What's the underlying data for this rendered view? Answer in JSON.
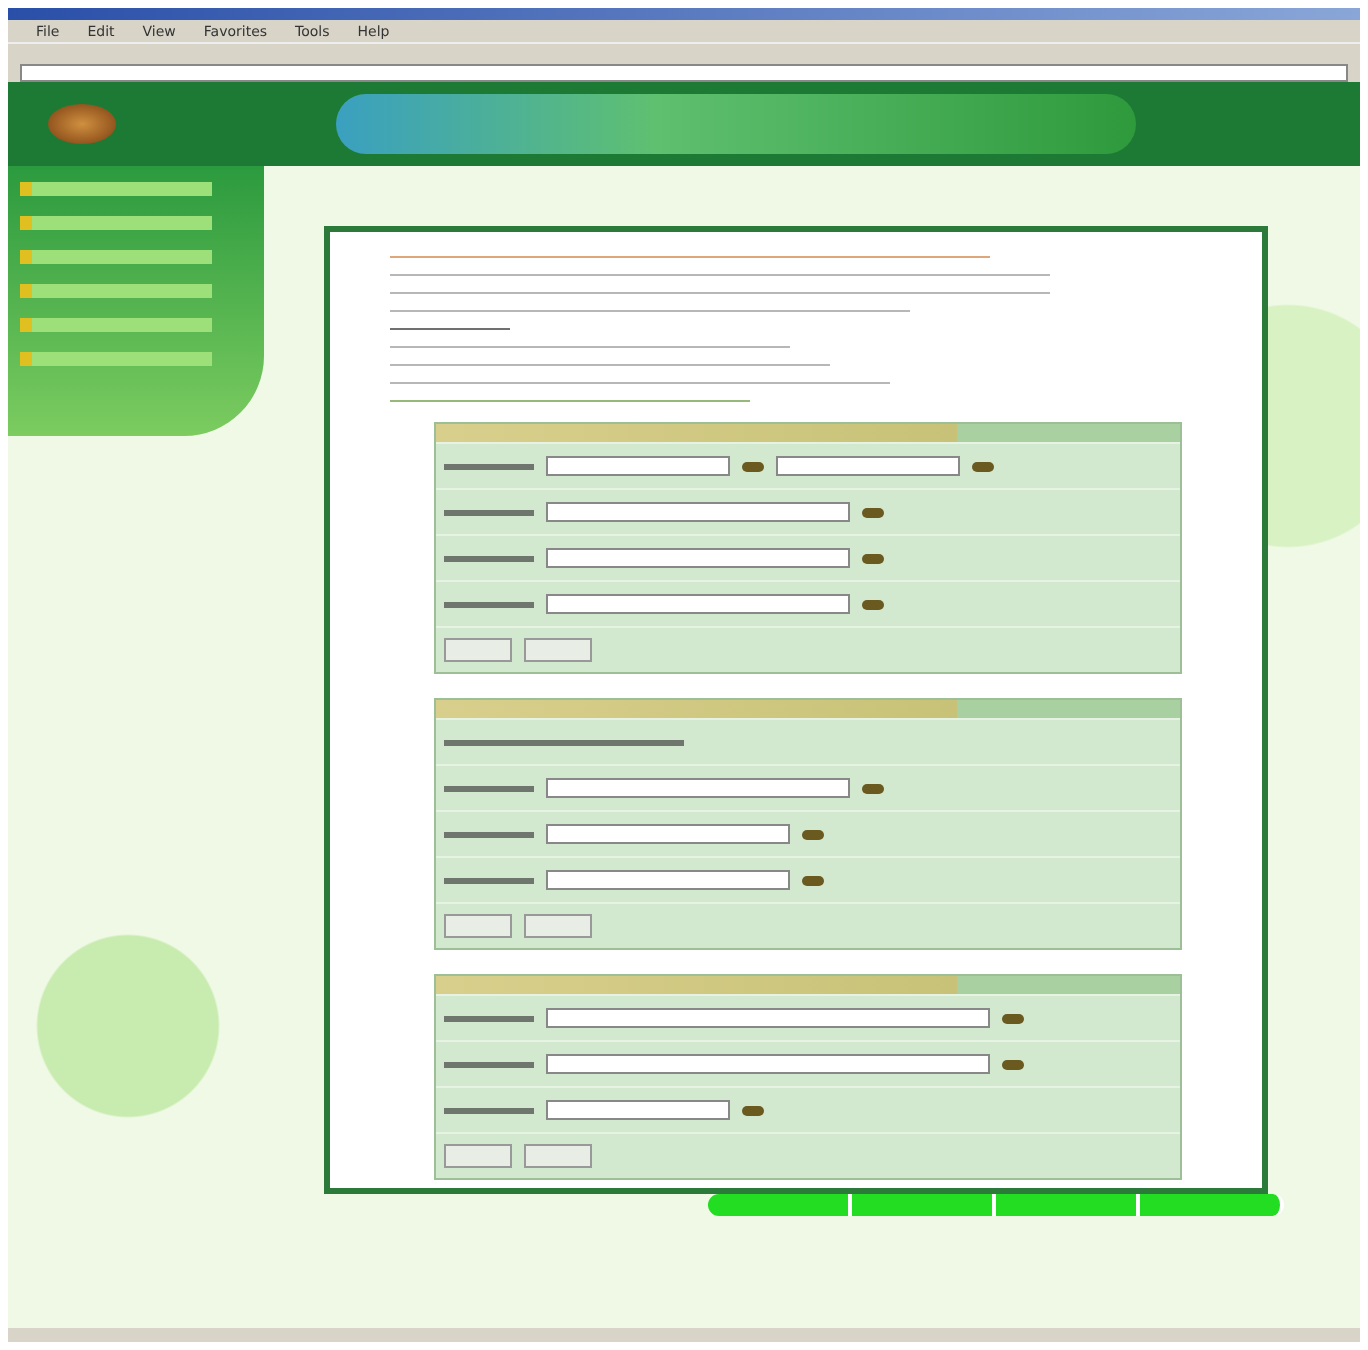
{
  "browser": {
    "menu": [
      "File",
      "Edit",
      "View",
      "Favorites",
      "Tools",
      "Help"
    ]
  },
  "panels": [
    {
      "rows": [
        {
          "kind": "input",
          "fields": [
            {
              "kind": "short"
            },
            {
              "kind": "short"
            }
          ]
        },
        {
          "kind": "input",
          "fields": [
            {
              "kind": "long"
            }
          ]
        },
        {
          "kind": "input",
          "fields": [
            {
              "kind": "long"
            }
          ]
        },
        {
          "kind": "input",
          "fields": [
            {
              "kind": "long"
            }
          ]
        },
        {
          "kind": "buttons"
        }
      ]
    },
    {
      "rows": [
        {
          "kind": "static"
        },
        {
          "kind": "input",
          "fields": [
            {
              "kind": "long"
            }
          ]
        },
        {
          "kind": "input",
          "fields": [
            {
              "kind": "medium"
            }
          ]
        },
        {
          "kind": "input",
          "fields": [
            {
              "kind": "medium"
            }
          ]
        },
        {
          "kind": "buttons"
        }
      ]
    },
    {
      "rows": [
        {
          "kind": "input",
          "fields": [
            {
              "kind": "wide"
            }
          ]
        },
        {
          "kind": "input",
          "fields": [
            {
              "kind": "wide"
            }
          ]
        },
        {
          "kind": "input",
          "fields": [
            {
              "kind": "short"
            }
          ]
        },
        {
          "kind": "buttons"
        }
      ]
    }
  ],
  "tabs": [
    {
      "selected": false
    },
    {
      "selected": false
    },
    {
      "selected": false
    },
    {
      "selected": false
    }
  ]
}
